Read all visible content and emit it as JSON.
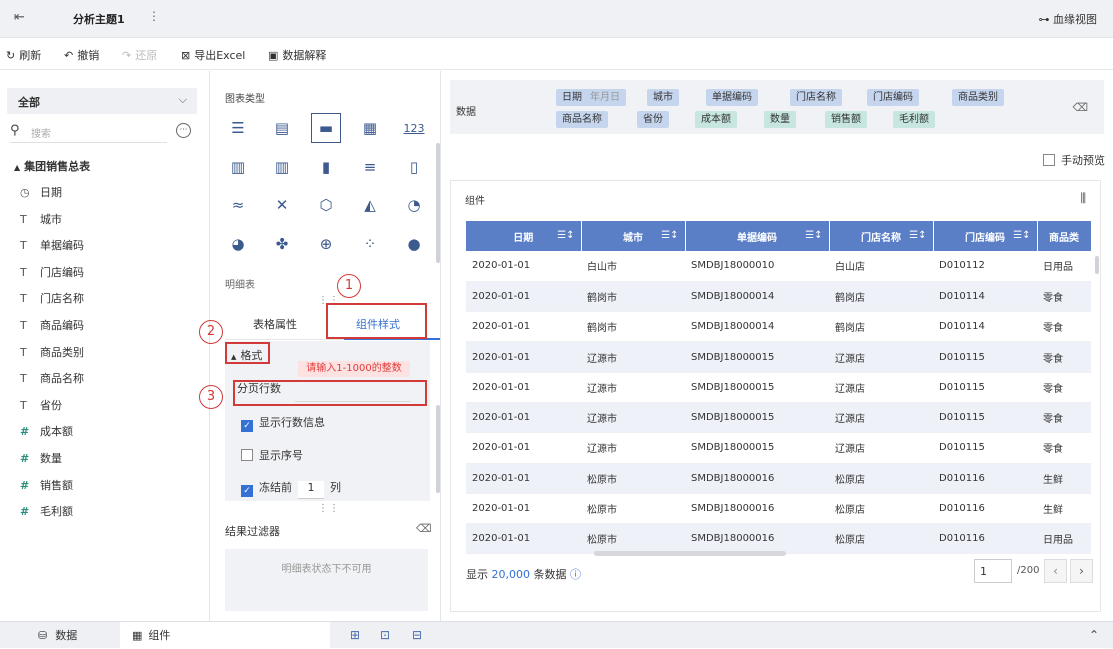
{
  "header": {
    "back_icon": "exit-icon",
    "title": "分析主题1",
    "more_icon": "⋮",
    "lineage_label": "血缘视图"
  },
  "toolbar": {
    "refresh": "刷新",
    "undo": "撤销",
    "redo": "还原",
    "export": "导出Excel",
    "explain": "数据解释"
  },
  "left": {
    "scope": "全部",
    "search_placeholder": "搜索",
    "tree_root": "集团销售总表",
    "fields": [
      {
        "icon": "clock-icon",
        "glyph": "◷",
        "label": "日期",
        "kind": "dim"
      },
      {
        "icon": "text-icon",
        "glyph": "T",
        "label": "城市",
        "kind": "dim"
      },
      {
        "icon": "text-icon",
        "glyph": "T",
        "label": "单据编码",
        "kind": "dim"
      },
      {
        "icon": "text-icon",
        "glyph": "T",
        "label": "门店编码",
        "kind": "dim"
      },
      {
        "icon": "text-icon",
        "glyph": "T",
        "label": "门店名称",
        "kind": "dim"
      },
      {
        "icon": "text-icon",
        "glyph": "T",
        "label": "商品编码",
        "kind": "dim"
      },
      {
        "icon": "text-icon",
        "glyph": "T",
        "label": "商品类别",
        "kind": "dim"
      },
      {
        "icon": "text-icon",
        "glyph": "T",
        "label": "商品名称",
        "kind": "dim"
      },
      {
        "icon": "text-icon",
        "glyph": "T",
        "label": "省份",
        "kind": "dim"
      },
      {
        "icon": "hash-icon",
        "glyph": "#",
        "label": "成本额",
        "kind": "mea"
      },
      {
        "icon": "hash-icon",
        "glyph": "#",
        "label": "数量",
        "kind": "mea"
      },
      {
        "icon": "hash-icon",
        "glyph": "#",
        "label": "销售额",
        "kind": "mea"
      },
      {
        "icon": "calc-hash-icon",
        "glyph": "#",
        "label": "毛利额",
        "kind": "mea"
      }
    ]
  },
  "middle": {
    "chart_type_label": "图表类型",
    "selected_chart_name": "明细表",
    "tab_table": "表格属性",
    "tab_style": "组件样式",
    "format_label": "格式",
    "error_tip": "请输入1-1000的整数",
    "page_rows_label": "分页行数",
    "show_rows_info": "显示行数信息",
    "show_index": "显示序号",
    "freeze_prefix": "冻结前",
    "freeze_value": "1",
    "freeze_suffix": "列",
    "result_filter_label": "结果过滤器",
    "result_filter_empty": "明细表状态下不可用",
    "annotations": [
      "1",
      "2",
      "3"
    ]
  },
  "right": {
    "data_label": "数据",
    "pills": [
      {
        "label": "日期",
        "sub": "年月日",
        "kind": "dim"
      },
      {
        "label": "城市",
        "kind": "dim"
      },
      {
        "label": "单据编码",
        "kind": "dim"
      },
      {
        "label": "门店名称",
        "kind": "dim"
      },
      {
        "label": "门店编码",
        "kind": "dim"
      },
      {
        "label": "商品类别",
        "kind": "dim"
      },
      {
        "label": "商品名称",
        "kind": "dim"
      },
      {
        "label": "省份",
        "kind": "dim"
      },
      {
        "label": "成本额",
        "kind": "mea"
      },
      {
        "label": "数量",
        "kind": "mea"
      },
      {
        "label": "销售额",
        "kind": "mea"
      },
      {
        "label": "毛利额",
        "kind": "mea"
      }
    ],
    "manual_preview": "手动预览",
    "component_title": "组件",
    "columns": [
      "日期",
      "城市",
      "单据编码",
      "门店名称",
      "门店编码",
      "商品类"
    ],
    "rows": [
      [
        "2020-01-01",
        "白山市",
        "SMDBJ18000010",
        "白山店",
        "D010112",
        "日用品"
      ],
      [
        "2020-01-01",
        "鹤岗市",
        "SMDBJ18000014",
        "鹤岗店",
        "D010114",
        "零食"
      ],
      [
        "2020-01-01",
        "鹤岗市",
        "SMDBJ18000014",
        "鹤岗店",
        "D010114",
        "零食"
      ],
      [
        "2020-01-01",
        "辽源市",
        "SMDBJ18000015",
        "辽源店",
        "D010115",
        "零食"
      ],
      [
        "2020-01-01",
        "辽源市",
        "SMDBJ18000015",
        "辽源店",
        "D010115",
        "零食"
      ],
      [
        "2020-01-01",
        "辽源市",
        "SMDBJ18000015",
        "辽源店",
        "D010115",
        "零食"
      ],
      [
        "2020-01-01",
        "辽源市",
        "SMDBJ18000015",
        "辽源店",
        "D010115",
        "零食"
      ],
      [
        "2020-01-01",
        "松原市",
        "SMDBJ18000016",
        "松原店",
        "D010116",
        "生鲜"
      ],
      [
        "2020-01-01",
        "松原市",
        "SMDBJ18000016",
        "松原店",
        "D010116",
        "生鲜"
      ],
      [
        "2020-01-01",
        "松原市",
        "SMDBJ18000016",
        "松原店",
        "D010116",
        "日用品"
      ]
    ],
    "count_prefix": "显示",
    "count_value": "20,000",
    "count_suffix": "条数据",
    "page_value": "1",
    "page_total": "/200"
  },
  "bottom": {
    "tab_data": "数据",
    "tab_component": "组件"
  }
}
